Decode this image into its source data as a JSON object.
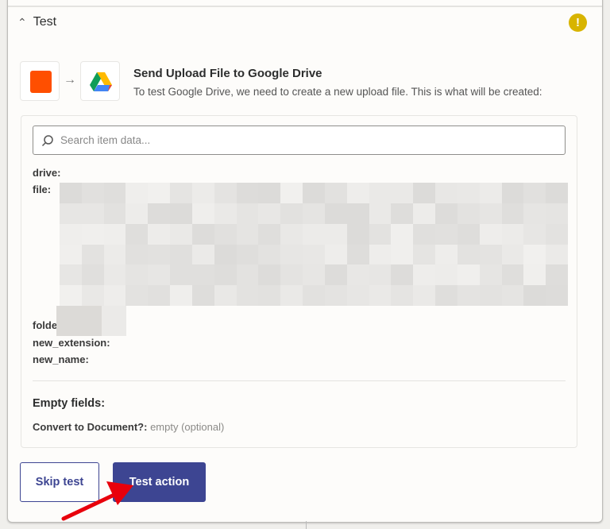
{
  "section": {
    "title": "Test",
    "warning_icon": "exclamation-icon"
  },
  "step": {
    "title": "Send Upload File to Google Drive",
    "subtitle": "To test Google Drive, we need to create a new upload file. This is what will be created:",
    "source_color": "#ff4f00"
  },
  "search": {
    "placeholder": "Search item data..."
  },
  "fields": [
    "drive:",
    "file:",
    "folder:",
    "new_extension:",
    "new_name:"
  ],
  "empty": {
    "heading": "Empty fields:",
    "label": "Convert to Document?:",
    "value": "empty (optional)"
  },
  "buttons": {
    "skip": "Skip test",
    "test": "Test action"
  },
  "colors": {
    "accent": "#3d4592",
    "warning": "#d8b400"
  }
}
